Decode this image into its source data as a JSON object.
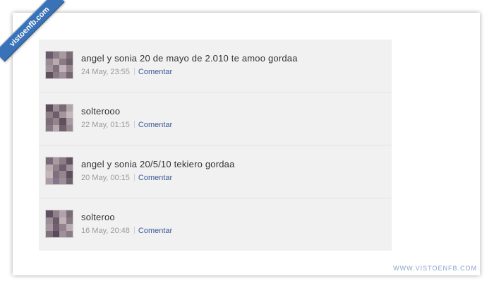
{
  "ribbon": {
    "label": "vistoenfb.com"
  },
  "feed": {
    "posts": [
      {
        "message": "angel y sonia 20 de mayo de 2.010 te amoo gordaa",
        "timestamp": "24 May, 23:55",
        "comment_label": "Comentar"
      },
      {
        "message": "solterooo",
        "timestamp": "22 May, 01:15",
        "comment_label": "Comentar"
      },
      {
        "message": "angel y sonia 20/5/10 tekiero gordaa",
        "timestamp": "20 May, 00:15",
        "comment_label": "Comentar"
      },
      {
        "message": "solteroo",
        "timestamp": "16 May, 20:48",
        "comment_label": "Comentar"
      }
    ]
  },
  "footer": {
    "watermark": "WWW.VISTOENFB.COM"
  },
  "colors": {
    "link": "#3b5998",
    "ribbon": "#3a72b8",
    "feed_background": "#f1f1f1"
  },
  "icons": {
    "avatar": "pixelated-avatar-icon"
  }
}
